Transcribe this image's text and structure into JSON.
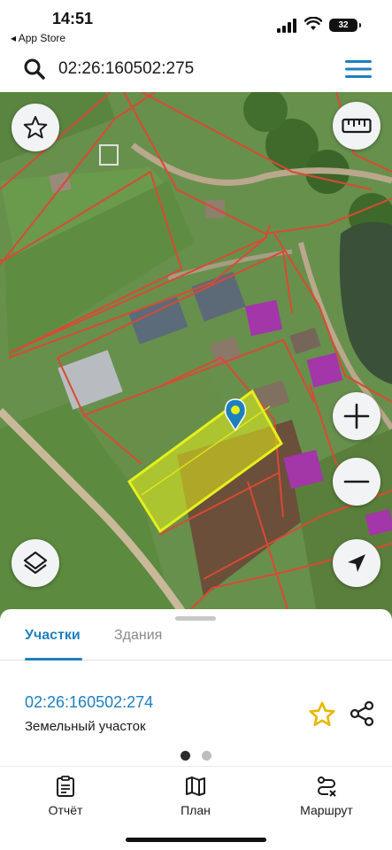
{
  "status_bar": {
    "time": "14:51",
    "back_app": "◂ App Store",
    "battery": "32"
  },
  "search": {
    "value": "02:26:160502:275",
    "icon": "search-icon",
    "menu_icon": "hamburger-menu-icon"
  },
  "map": {
    "highlight_color": "#e6f01a",
    "boundary_color": "#d94a33",
    "marker_color": "#1e7fbf",
    "controls": {
      "favorites_icon": "star-icon",
      "ruler_icon": "ruler-icon",
      "zoom_in_icon": "plus-icon",
      "zoom_out_icon": "minus-icon",
      "layers_icon": "layers-icon",
      "location_icon": "navigation-arrow-icon"
    }
  },
  "sheet": {
    "tabs": [
      {
        "label": "Участки",
        "active": true
      },
      {
        "label": "Здания",
        "active": false
      }
    ],
    "result": {
      "number": "02:26:160502:274",
      "type": "Земельный участок"
    },
    "page": 1,
    "pages": 2
  },
  "bottom_nav": [
    {
      "label": "Отчёт",
      "icon": "report-clipboard-icon"
    },
    {
      "label": "План",
      "icon": "map-plan-icon"
    },
    {
      "label": "Маршрут",
      "icon": "route-icon"
    }
  ],
  "colors": {
    "accent": "#1e7fbf",
    "favorite_star": "#e7b800"
  }
}
